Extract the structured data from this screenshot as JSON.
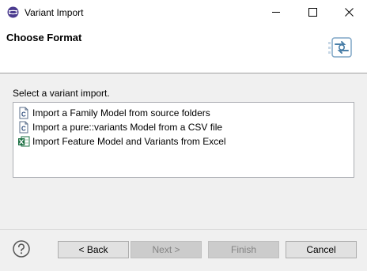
{
  "window": {
    "title": "Variant Import",
    "controls": [
      "minimize-icon",
      "maximize-icon",
      "close-icon"
    ]
  },
  "header": {
    "title": "Choose Format",
    "icon": "import-wizard-icon"
  },
  "main": {
    "prompt": "Select a variant import.",
    "items": [
      {
        "label": "Import a Family Model from source folders",
        "icon": "c-file-icon"
      },
      {
        "label": "Import a pure::variants Model from a CSV file",
        "icon": "c-file-icon"
      },
      {
        "label": "Import Feature Model and Variants from Excel",
        "icon": "excel-icon"
      }
    ]
  },
  "footer": {
    "help_icon": "help-icon",
    "back_label": "< Back",
    "next_label": "Next >",
    "finish_label": "Finish",
    "cancel_label": "Cancel",
    "next_enabled": false,
    "finish_enabled": false
  },
  "colors": {
    "app_icon": "#4b3b8f",
    "wizard_icon": "#4a7fa8",
    "excel": "#1d7044"
  }
}
